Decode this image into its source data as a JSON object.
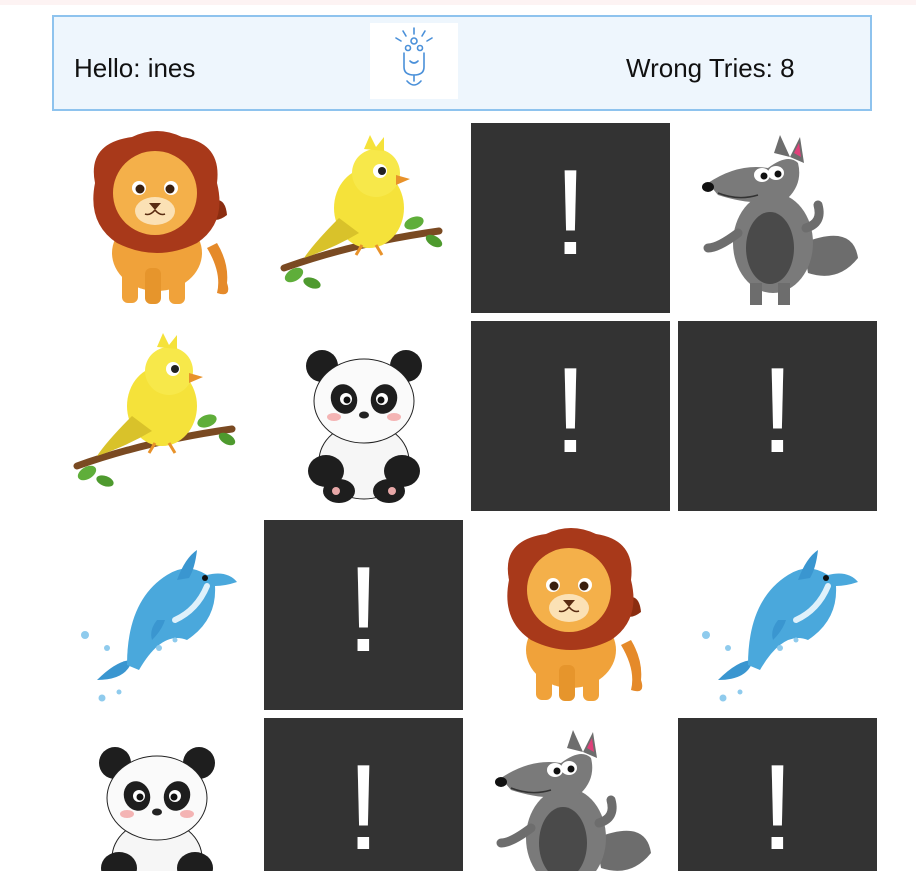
{
  "header": {
    "greeting": "Hello: ines",
    "wrong_tries": "Wrong Tries: 8",
    "logo_icon": "brain-lightbulb-logo-icon"
  },
  "board": {
    "hidden_mark": "!",
    "rows": [
      [
        "lion",
        "bird",
        "hidden",
        "wolf"
      ],
      [
        "bird",
        "panda",
        "hidden",
        "hidden"
      ],
      [
        "dolphin",
        "hidden",
        "lion",
        "dolphin"
      ],
      [
        "panda",
        "hidden",
        "wolf",
        "hidden"
      ]
    ]
  },
  "colors": {
    "hidden_card": "#333333",
    "header_bg": "#eef6fd",
    "header_border": "#8ec3ee",
    "accent": "#4a90d9"
  }
}
